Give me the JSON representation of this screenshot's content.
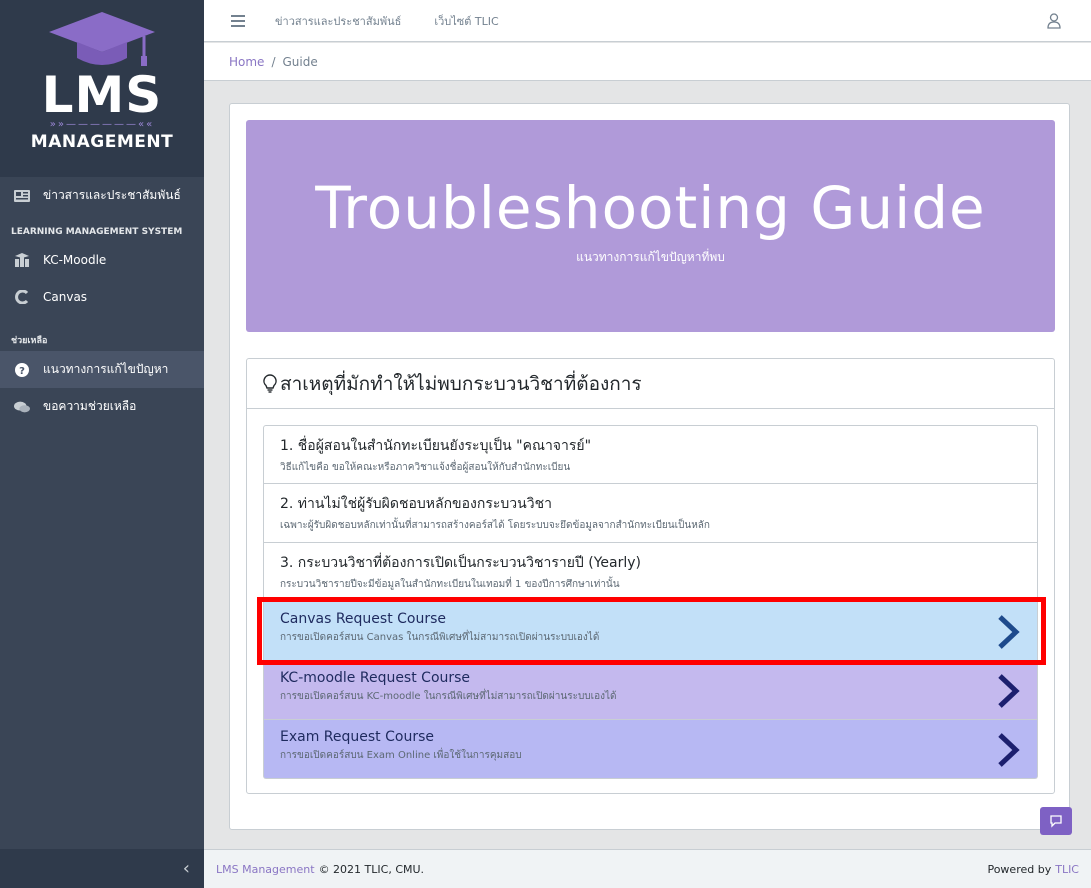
{
  "brand": {
    "logo_text": "LMS",
    "logo_sub": "MANAGEMENT",
    "colors": {
      "cap": "#8a6cc7",
      "arrows": "#9b87d6"
    }
  },
  "sidebar": {
    "items_top": [
      {
        "label": "ข่าวสารและประชาสัมพันธ์",
        "icon": "newspaper-icon"
      }
    ],
    "section_lms": "LEARNING MANAGEMENT SYSTEM",
    "items_lms": [
      {
        "label": "KC-Moodle",
        "icon": "moodle-icon"
      },
      {
        "label": "Canvas",
        "icon": "canvas-icon"
      }
    ],
    "section_help": "ช่วยเหลือ",
    "items_help": [
      {
        "label": "แนวทางการแก้ไขปัญหา",
        "icon": "question-circle-icon",
        "active": true
      },
      {
        "label": "ขอความช่วยเหลือ",
        "icon": "chat-bubbles-icon"
      }
    ]
  },
  "header": {
    "links": [
      "ข่าวสารและประชาสัมพันธ์",
      "เว็บไซต์ TLIC"
    ]
  },
  "breadcrumb": {
    "home": "Home",
    "sep": "/",
    "current": "Guide"
  },
  "hero": {
    "title": "Troubleshooting Guide",
    "subtitle": "แนวทางการแก้ไขปัญหาที่พบ",
    "color": "#b09ad9"
  },
  "panel": {
    "heading": "สาเหตุที่มักทำให้ไม่พบกระบวนวิชาที่ต้องการ",
    "items": [
      {
        "title": "1. ชื่อผู้สอนในสำนักทะเบียนยังระบุเป็น \"คณาจารย์\"",
        "desc": "วิธีแก้ไขคือ ขอให้คณะหรือภาควิชาแจ้งชื่อผู้สอนให้กับสำนักทะเบียน"
      },
      {
        "title": "2. ท่านไม่ใช่ผู้รับผิดชอบหลักของกระบวนวิชา",
        "desc": "เฉพาะผู้รับผิดชอบหลักเท่านั้นที่สามารถสร้างคอร์สได้ โดยระบบจะยึดข้อมูลจากสำนักทะเบียนเป็นหลัก"
      },
      {
        "title": "3. กระบวนวิชาที่ต้องการเปิดเป็นกระบวนวิชารายปี (Yearly)",
        "desc": "กระบวนวิชารายปีจะมีข้อมูลในสำนักทะเบียนในเทอมที่ 1 ของปีการศึกษาเท่านั้น"
      }
    ],
    "actions": [
      {
        "title": "Canvas Request Course",
        "desc": "การขอเปิดคอร์สบน Canvas ในกรณีพิเศษที่ไม่สามารถเปิดผ่านระบบเองได้",
        "color": "#c2e0f8"
      },
      {
        "title": "KC-moodle Request Course",
        "desc": "การขอเปิดคอร์สบน KC-moodle ในกรณีพิเศษที่ไม่สามารถเปิดผ่านระบบเองได้",
        "color": "#c4b9ee"
      },
      {
        "title": "Exam Request Course",
        "desc": "การขอเปิดคอร์สบน Exam Online เพื่อใช้ในการคุมสอบ",
        "color": "#b7b8f3"
      }
    ]
  },
  "footer": {
    "brand_link": "LMS Management",
    "copyright": "© 2021 TLIC, CMU.",
    "powered": "Powered by",
    "powered_link": "TLIC"
  },
  "highlight_color": "#ff0000"
}
